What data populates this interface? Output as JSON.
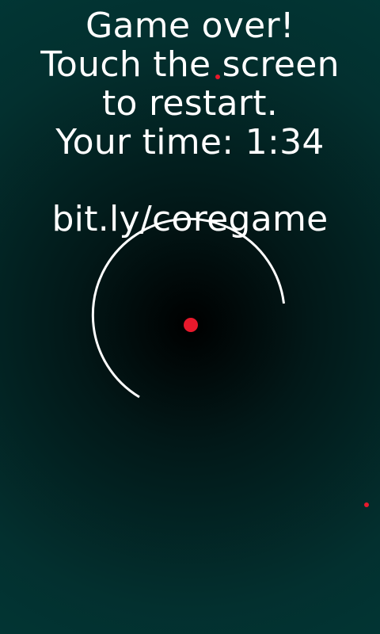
{
  "game": {
    "title": "Game over!",
    "instruction_line1": "Touch the screen",
    "instruction_line2": "to restart.",
    "time_label": "Your time:",
    "time_value": "1:34",
    "time_text": "Your time: 1:34",
    "link": "bit.ly/coregame"
  },
  "colors": {
    "background_center": "#000000",
    "background_edge": "#003a38",
    "text": "#ffffff",
    "core": "#e8192c",
    "particle": "#e8192c",
    "shield": "#ffffff"
  }
}
